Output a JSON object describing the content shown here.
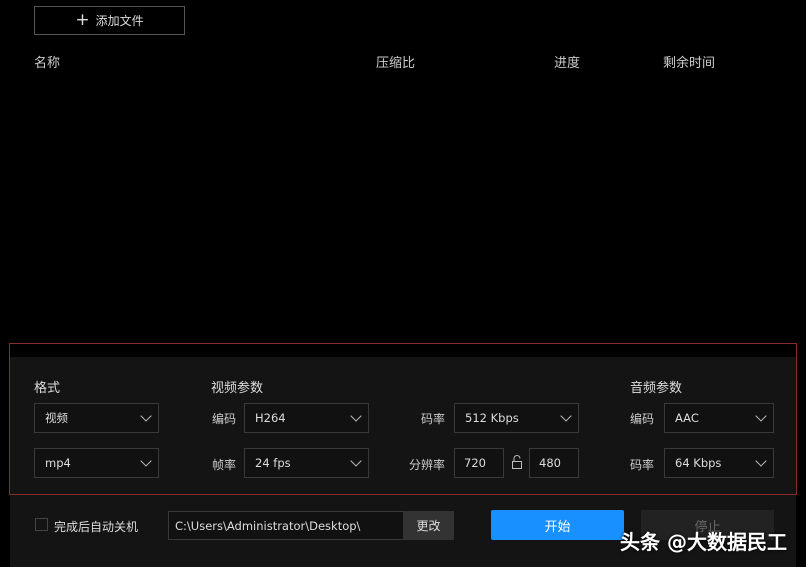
{
  "toolbar": {
    "add_file": "添加文件"
  },
  "columns": {
    "name": "名称",
    "ratio": "压缩比",
    "progress": "进度",
    "remaining": "剩余时间"
  },
  "format": {
    "title": "格式",
    "type": "视频",
    "container": "mp4"
  },
  "video": {
    "title": "视频参数",
    "codec_label": "编码",
    "codec": "H264",
    "fps_label": "帧率",
    "fps": "24 fps",
    "bitrate_label": "码率",
    "bitrate": "512 Kbps",
    "res_label": "分辨率",
    "width": "720",
    "height": "480"
  },
  "audio": {
    "title": "音频参数",
    "codec_label": "编码",
    "codec": "AAC",
    "bitrate_label": "码率",
    "bitrate": "64 Kbps"
  },
  "footer": {
    "shutdown": "完成后自动关机",
    "path": "C:\\Users\\Administrator\\Desktop\\",
    "change": "更改",
    "start": "开始",
    "stop": "停止"
  },
  "watermark": "头条 @大数据民工",
  "colors": {
    "accent": "#1890ff",
    "highlight": "#8a2b2b"
  }
}
